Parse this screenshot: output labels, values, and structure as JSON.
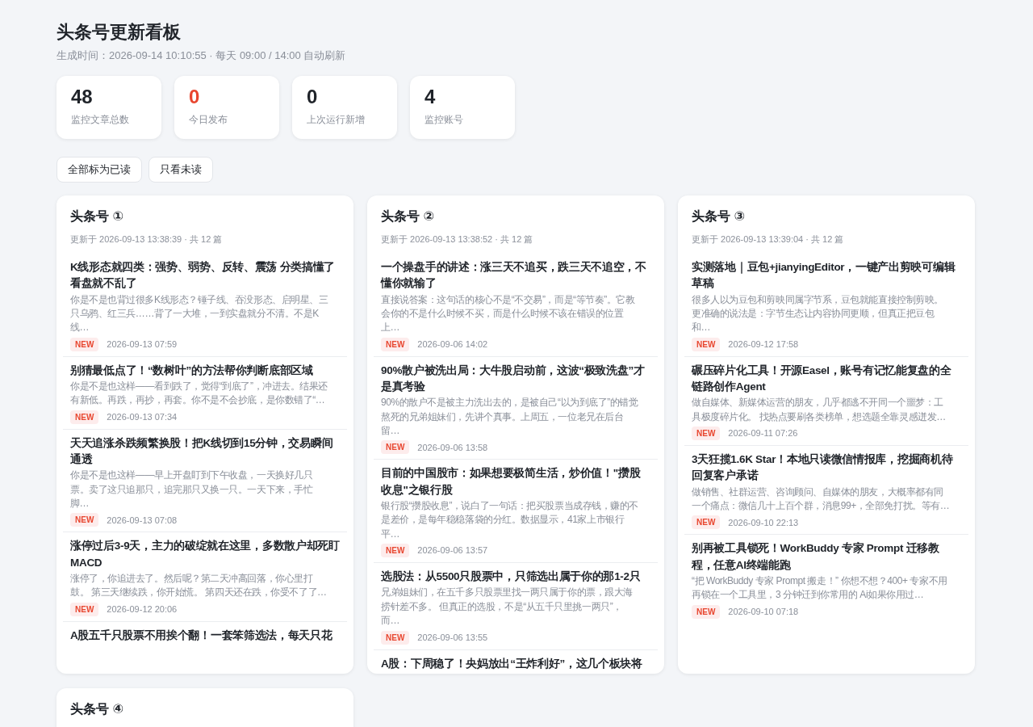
{
  "title": "头条号更新看板",
  "subtitle": "生成时间：2026-09-14 10:10:55 · 每天 09:00 / 14:00 自动刷新",
  "stats": [
    {
      "value": "48",
      "label": "监控文章总数",
      "color": "#1f2329"
    },
    {
      "value": "0",
      "label": "今日发布",
      "color": "#e8462f"
    },
    {
      "value": "0",
      "label": "上次运行新增",
      "color": "#1f2329"
    },
    {
      "value": "4",
      "label": "监控账号",
      "color": "#1f2329"
    }
  ],
  "actions": [
    "全部标为已读",
    "只看未读"
  ],
  "accounts": [
    {
      "name": "头条号 ①",
      "meta": "更新于 2026-09-13 13:38:39 · 共 12 篇",
      "articles": [
        {
          "title": "K线形态就四类：强势、弱势、反转、震荡 分类搞懂了看盘就不乱了",
          "summary": "你是不是也背过很多K线形态？锤子线、吞没形态、启明星、三只乌鸦、红三兵……背了一大堆，一到实盘就分不清。不是K线…",
          "badge": "NEW",
          "time": "2026-09-13 07:59"
        },
        {
          "title": "别猜最低点了！“数树叶”的方法帮你判断底部区域",
          "summary": "你是不是也这样——看到跌了，觉得“到底了”，冲进去。结果还有新低。再跌，再抄，再套。你不是不会抄底，是你数错了“…",
          "badge": "NEW",
          "time": "2026-09-13 07:34"
        },
        {
          "title": "天天追涨杀跌频繁换股！把K线切到15分钟，交易瞬间通透",
          "summary": "你是不是也这样——早上开盘盯到下午收盘，一天换好几只票。卖了这只追那只，追完那只又换一只。一天下来，手忙脚…",
          "badge": "NEW",
          "time": "2026-09-13 07:08"
        },
        {
          "title": "涨停过后3-9天，主力的破绽就在这里，多数散户却死盯MACD",
          "summary": "涨停了，你追进去了。然后呢？第二天冲高回落，你心里打鼓。 第三天继续跌，你开始慌。 第四天还在跌，你受不了了…",
          "badge": "NEW",
          "time": "2026-09-12 20:06"
        },
        {
          "title": "A股五千只股票不用挨个翻！一套笨筛选法，每天只花"
        }
      ]
    },
    {
      "name": "头条号 ②",
      "meta": "更新于 2026-09-13 13:38:52 · 共 12 篇",
      "articles": [
        {
          "title": "一个操盘手的讲述：涨三天不追买，跌三天不追空，不懂你就输了",
          "summary": "直接说答案：这句话的核心不是“不交易”，而是“等节奏”。它教会你的不是什么时候不买，而是什么时候不该在错误的位置上…",
          "badge": "NEW",
          "time": "2026-09-06 14:02"
        },
        {
          "title": "90%散户被洗出局：大牛股启动前，这波“极致洗盘”才是真考验",
          "summary": "90%的散户不是被主力洗出去的，是被自己“以为到底了”的错觉熬死的兄弟姐妹们，先讲个真事。上周五，一位老兄在后台留…",
          "badge": "NEW",
          "time": "2026-09-06 13:58"
        },
        {
          "title": "目前的中国股市：如果想要极简生活，炒价值！\"攒股收息\"之银行股",
          "summary": "银行股“攒股收息”，说白了一句话：把买股票当成存钱，赚的不是差价，是每年稳稳落袋的分红。数据显示，41家上市银行平…",
          "badge": "NEW",
          "time": "2026-09-06 13:57"
        },
        {
          "title": "选股法：从5500只股票中，只筛选出属于你的那1-2只",
          "summary": "兄弟姐妹们，在五千多只股票里找一两只属于你的票，跟大海捞针差不多。 但真正的选股，不是“从五千只里挑一两只”，而…",
          "badge": "NEW",
          "time": "2026-09-06 13:55"
        },
        {
          "title": "A股：下周稳了！央妈放出“王炸利好”，这几个板块将"
        }
      ]
    },
    {
      "name": "头条号 ③",
      "meta": "更新于 2026-09-13 13:39:04 · 共 12 篇",
      "articles": [
        {
          "title": "实测落地｜豆包+jianyingEditor，一键产出剪映可编辑草稿",
          "summary": "很多人以为豆包和剪映同属字节系，豆包就能直接控制剪映。更准确的说法是：字节生态让内容协同更顺，但真正把豆包和…",
          "badge": "NEW",
          "time": "2026-09-12 17:58"
        },
        {
          "title": "碾压碎片化工具！开源Easel，账号有记忆能复盘的全链路创作Agent",
          "summary": "做自媒体、新媒体运营的朋友，几乎都逃不开同一个噩梦：工具极度碎片化。 找热点要刷各类榜单，想选题全靠灵感迸发…",
          "badge": "NEW",
          "time": "2026-09-11 07:26"
        },
        {
          "title": "3天狂揽1.6K Star！本地只读微信情报库，挖掘商机待回复客户承诺",
          "summary": "做销售、社群运营、咨询顾问、自媒体的朋友，大概率都有同一个痛点：微信几十上百个群，消息99+，全部免打扰。等有…",
          "badge": "NEW",
          "time": "2026-09-10 22:13"
        },
        {
          "title": "别再被工具锁死！WorkBuddy 专家 Prompt 迁移教程，任意AI终端能跑",
          "summary": "“把 WorkBuddy 专家 Prompt 搬走！” 你想不想？400+ 专家不用再锁在一个工具里，3 分钟迁到你常用的 Ai如果你用过…",
          "badge": "NEW",
          "time": "2026-09-10 07:18"
        }
      ]
    },
    {
      "name": "头条号 ④"
    }
  ]
}
